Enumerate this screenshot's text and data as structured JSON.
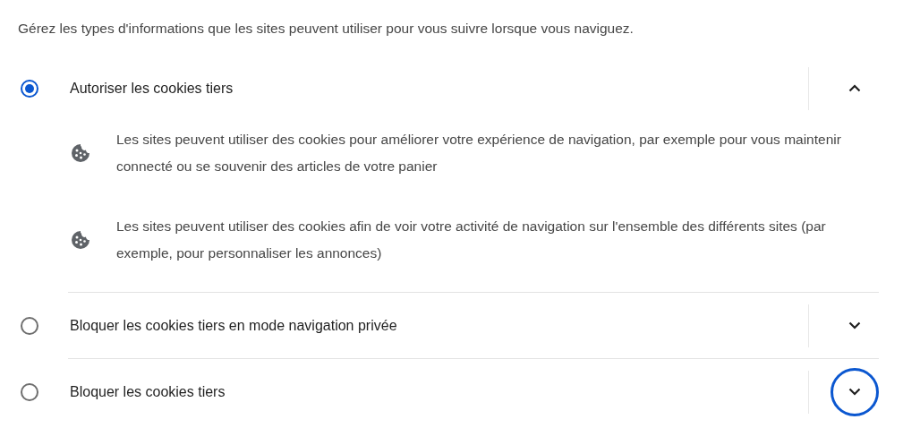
{
  "description": "Gérez les types d'informations que les sites peuvent utiliser pour vous suivre lorsque vous naviguez.",
  "options": [
    {
      "label": "Autoriser les cookies tiers",
      "selected": true,
      "expanded": true,
      "focused": false,
      "details": [
        "Les sites peuvent utiliser des cookies pour améliorer votre expérience de navigation, par exemple pour vous maintenir connecté ou se souvenir des articles de votre panier",
        "Les sites peuvent utiliser des cookies afin de voir votre activité de navigation sur l'ensemble des différents sites (par exemple, pour personnaliser les annonces)"
      ]
    },
    {
      "label": "Bloquer les cookies tiers en mode navigation privée",
      "selected": false,
      "expanded": false,
      "focused": false
    },
    {
      "label": "Bloquer les cookies tiers",
      "selected": false,
      "expanded": false,
      "focused": true
    }
  ]
}
